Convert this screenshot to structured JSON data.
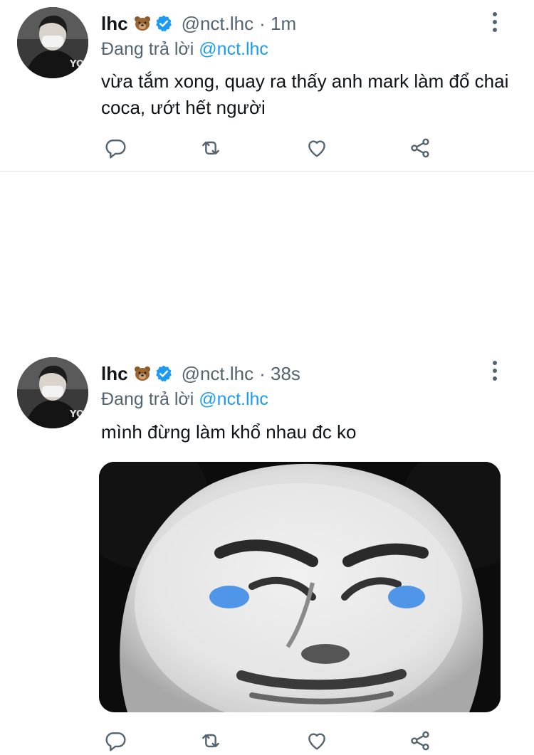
{
  "tweets": [
    {
      "name": "lhc",
      "emoji_icon": "bear-face-emoji",
      "verified_icon": "verified-badge-icon",
      "handle": "@nct.lhc",
      "time": "· 1m",
      "replying_prefix": "Đang trả lời",
      "replying_to": "@nct.lhc",
      "text": "vừa tắm xong, quay ra thấy anh mark làm đổ chai coca, ướt hết người",
      "actions": [
        "reply-icon",
        "retweet-icon",
        "like-icon",
        "share-icon"
      ]
    },
    {
      "name": "lhc",
      "emoji_icon": "bear-face-emoji",
      "verified_icon": "verified-badge-icon",
      "handle": "@nct.lhc",
      "time": "· 38s",
      "replying_prefix": "Đang trả lời",
      "replying_to": "@nct.lhc",
      "text": "mình đừng làm khổ nhau đc ko",
      "media": "meme-face-image",
      "actions": [
        "reply-icon",
        "retweet-icon",
        "like-icon",
        "share-icon"
      ]
    }
  ],
  "colors": {
    "accent": "#1d9bf0",
    "secondary_text": "#536471",
    "primary_text": "#0f1419",
    "divider": "#e1e8ed"
  }
}
